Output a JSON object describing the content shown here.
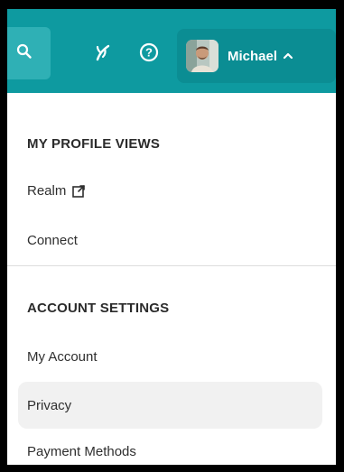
{
  "header": {
    "user_name": "Michael",
    "icons": {
      "search": "search-icon",
      "growth": "growth-leaf-icon",
      "help": "help-icon",
      "chevron": "chevron-up-icon"
    },
    "colors": {
      "bar": "#0e9aa0",
      "user_pill": "#0b8d93"
    }
  },
  "menu": {
    "profile_views_heading": "MY PROFILE VIEWS",
    "realm_label": "Realm",
    "connect_label": "Connect",
    "account_settings_heading": "ACCOUNT SETTINGS",
    "my_account_label": "My Account",
    "privacy_label": "Privacy",
    "payment_methods_label": "Payment Methods",
    "realm_icon": "external-link-icon"
  }
}
